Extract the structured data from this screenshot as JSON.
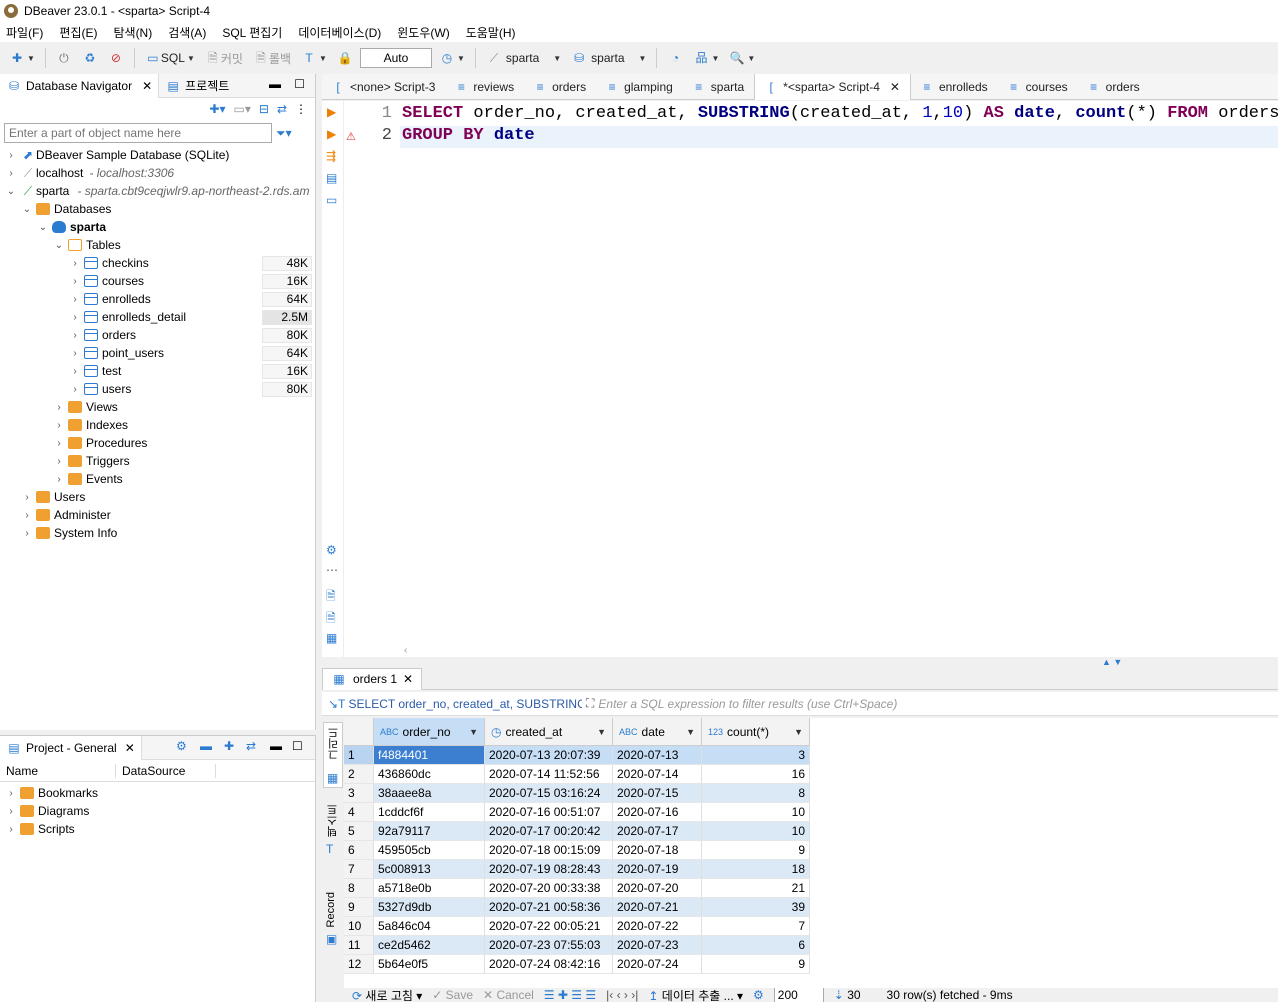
{
  "window": {
    "title": "DBeaver 23.0.1 - <sparta> Script-4"
  },
  "menu": [
    "파일(F)",
    "편집(E)",
    "탐색(N)",
    "검색(A)",
    "SQL 편집기",
    "데이터베이스(D)",
    "윈도우(W)",
    "도움말(H)"
  ],
  "toolbar": {
    "sql_label": "SQL",
    "commit_label": "커밋",
    "rollback_label": "롤백",
    "mode_value": "Auto",
    "datasource": "sparta",
    "schema": "sparta"
  },
  "navigator": {
    "tab_label": "Database Navigator",
    "project_tab_label": "프로젝트",
    "filter_placeholder": "Enter a part of object name here",
    "connections": [
      {
        "name": "DBeaver Sample Database (SQLite)",
        "host": ""
      },
      {
        "name": "localhost",
        "host": "- localhost:3306"
      },
      {
        "name": "sparta",
        "host": "- sparta.cbt9ceqjwlr9.ap-northeast-2.rds.am"
      }
    ],
    "databases_label": "Databases",
    "schema_name": "sparta",
    "tables_label": "Tables",
    "tables": [
      {
        "name": "checkins",
        "size": "48K"
      },
      {
        "name": "courses",
        "size": "16K"
      },
      {
        "name": "enrolleds",
        "size": "64K"
      },
      {
        "name": "enrolleds_detail",
        "size": "2.5M"
      },
      {
        "name": "orders",
        "size": "80K"
      },
      {
        "name": "point_users",
        "size": "64K"
      },
      {
        "name": "test",
        "size": "16K"
      },
      {
        "name": "users",
        "size": "80K"
      }
    ],
    "folders": [
      "Views",
      "Indexes",
      "Procedures",
      "Triggers",
      "Events"
    ],
    "bottom_nodes": [
      "Users",
      "Administer",
      "System Info"
    ]
  },
  "project": {
    "tab_label": "Project - General",
    "columns": [
      "Name",
      "DataSource"
    ],
    "items": [
      "Bookmarks",
      "Diagrams",
      "Scripts"
    ]
  },
  "editor_tabs": [
    "<none> Script-3",
    "reviews",
    "orders",
    "glamping",
    "sparta",
    "*<sparta> Script-4",
    "enrolleds",
    "courses",
    "orders"
  ],
  "editor": {
    "line1_no": "1",
    "line2_no": "2",
    "line1": {
      "select": "SELECT",
      "cols": " order_no, created_at, ",
      "func": "SUBSTRING",
      "args1": "(created_at, ",
      "n1": "1",
      "comma": ",",
      "n2": "10",
      "args2": ") ",
      "as": "AS",
      "alias": " date",
      "comma2": ", ",
      "count": "count",
      "star": "(*) ",
      "from": "FROM",
      "table": " orders"
    },
    "line2": {
      "group": "GROUP BY",
      "col": " date"
    }
  },
  "results": {
    "tab_label": "orders 1",
    "sql_preview": "SELECT order_no, created_at, SUBSTRING(cr",
    "filter_placeholder": "Enter a SQL expression to filter results (use Ctrl+Space)",
    "side_tabs": [
      "그리드",
      "텍스트",
      "Record"
    ],
    "columns": [
      "order_no",
      "created_at",
      "date",
      "count(*)"
    ],
    "rows": [
      {
        "n": "1",
        "order_no": "f4884401",
        "created_at": "2020-07-13 20:07:39",
        "date": "2020-07-13",
        "count": "3"
      },
      {
        "n": "2",
        "order_no": "436860dc",
        "created_at": "2020-07-14 11:52:56",
        "date": "2020-07-14",
        "count": "16"
      },
      {
        "n": "3",
        "order_no": "38aaee8a",
        "created_at": "2020-07-15 03:16:24",
        "date": "2020-07-15",
        "count": "8"
      },
      {
        "n": "4",
        "order_no": "1cddcf6f",
        "created_at": "2020-07-16 00:51:07",
        "date": "2020-07-16",
        "count": "10"
      },
      {
        "n": "5",
        "order_no": "92a79117",
        "created_at": "2020-07-17 00:20:42",
        "date": "2020-07-17",
        "count": "10"
      },
      {
        "n": "6",
        "order_no": "459505cb",
        "created_at": "2020-07-18 00:15:09",
        "date": "2020-07-18",
        "count": "9"
      },
      {
        "n": "7",
        "order_no": "5c008913",
        "created_at": "2020-07-19 08:28:43",
        "date": "2020-07-19",
        "count": "18"
      },
      {
        "n": "8",
        "order_no": "a5718e0b",
        "created_at": "2020-07-20 00:33:38",
        "date": "2020-07-20",
        "count": "21"
      },
      {
        "n": "9",
        "order_no": "5327d9db",
        "created_at": "2020-07-21 00:58:36",
        "date": "2020-07-21",
        "count": "39"
      },
      {
        "n": "10",
        "order_no": "5a846c04",
        "created_at": "2020-07-22 00:05:21",
        "date": "2020-07-22",
        "count": "7"
      },
      {
        "n": "11",
        "order_no": "ce2d5462",
        "created_at": "2020-07-23 07:55:03",
        "date": "2020-07-23",
        "count": "6"
      },
      {
        "n": "12",
        "order_no": "5b64e0f5",
        "created_at": "2020-07-24 08:42:16",
        "date": "2020-07-24",
        "count": "9"
      }
    ]
  },
  "statusbar": {
    "refresh_label": "새로 고침",
    "save_label": "Save",
    "cancel_label": "Cancel",
    "export_label": "데이터 추출 ...",
    "fetch_size": "200",
    "fetch_count": "30",
    "fetched_text": "30 row(s) fetched - 9ms"
  },
  "colors": {
    "selected_row": "#c5ddf5",
    "alt_row": "#dbe8f6",
    "keyword": "#7f0055",
    "accent": "#2b7bd0"
  }
}
